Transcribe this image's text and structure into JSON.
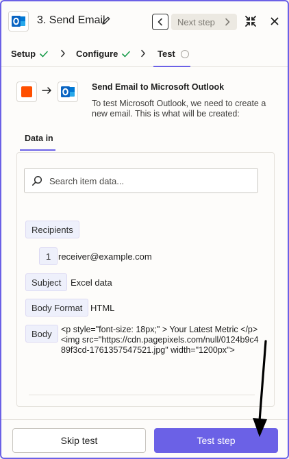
{
  "header": {
    "title": "3. Send Email",
    "next_step_label": "Next step",
    "app_icon": "microsoft-outlook-icon"
  },
  "tabs": [
    {
      "label": "Setup",
      "status": "complete"
    },
    {
      "label": "Configure",
      "status": "complete"
    },
    {
      "label": "Test",
      "status": "pending"
    }
  ],
  "intro": {
    "title": "Send Email to Microsoft Outlook",
    "description": "To test Microsoft Outlook, we need to create a new email. This is what will be created:"
  },
  "data_in": {
    "tab_label": "Data in",
    "search_placeholder": "Search item data...",
    "fields": {
      "recipients_label": "Recipients",
      "recipient_index": "1",
      "recipient_value": "receiver@example.com",
      "subject_label": "Subject",
      "subject_value": "Excel data",
      "body_format_label": "Body Format",
      "body_format_value": "HTML",
      "body_label": "Body",
      "body_value": "<p style=\"font-size: 18px;\" > Your Latest Metric </p>\n<img src=\"https://cdn.pagepixels.com/null/0124b9c489f3cd-1761357547521.jpg\" width=\"1200px\">"
    }
  },
  "footer": {
    "skip_label": "Skip test",
    "test_label": "Test step"
  },
  "colors": {
    "accent": "#6b61e6",
    "success": "#1a9c4b",
    "zapier_orange": "#ff4f00",
    "outlook_blue": "#0a64c2"
  }
}
